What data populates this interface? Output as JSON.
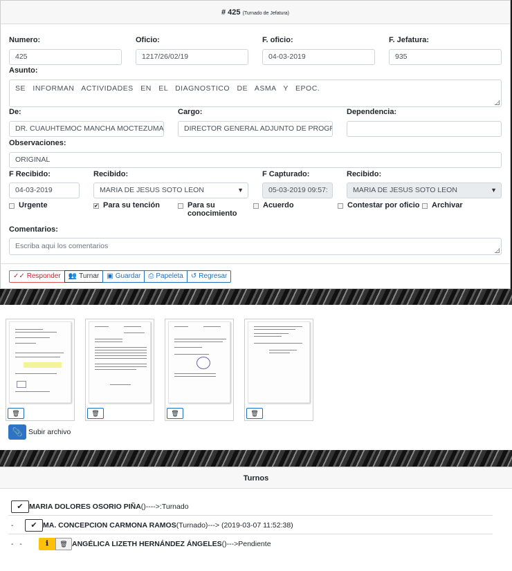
{
  "header": {
    "title": "# 425",
    "subtitle": "(Turnado de Jefatura)"
  },
  "form": {
    "numero": {
      "label": "Numero:",
      "value": "425"
    },
    "oficio": {
      "label": "Oficio:",
      "value": "1217/26/02/19"
    },
    "f_oficio": {
      "label": "F. oficio:",
      "value": "04-03-2019"
    },
    "f_jefatura": {
      "label": "F. Jefatura:",
      "value": "935"
    },
    "asunto": {
      "label": "Asunto:",
      "value": "SE INFORMAN ACTIVIDADES EN EL DIAGNOSTICO DE ASMA Y EPOC."
    },
    "de": {
      "label": "De:",
      "value": "DR. CUAUHTEMOC MANCHA MOCTEZUMA"
    },
    "cargo": {
      "label": "Cargo:",
      "value": "DIRECTOR GENERAL ADJUNTO DE PROGRAI"
    },
    "dependencia": {
      "label": "Dependencia:",
      "value": ""
    },
    "observaciones": {
      "label": "Observaciones:",
      "value": "ORIGINAL"
    },
    "f_recibido": {
      "label": "F Recibido:",
      "value": "04-03-2019"
    },
    "recibido": {
      "label": "Recibido:",
      "value": "MARIA DE JESUS SOTO LEON"
    },
    "f_capturado": {
      "label": "F Capturado:",
      "value": "05-03-2019 09:57:"
    },
    "recibido2": {
      "label": "Recibido:",
      "value": "MARIA DE JESUS SOTO LEON"
    },
    "checks": {
      "urgente": "Urgente",
      "tencion": "Para su tención",
      "conocimiento_1": "Para su",
      "conocimiento_2": "conocimiento",
      "acuerdo": "Acuerdo",
      "contestar": "Contestar por oficio",
      "archivar": "Archivar"
    },
    "comentarios": {
      "label": "Comentarios:",
      "placeholder": "Escriba aqui los comentarios"
    }
  },
  "buttons": {
    "responder": "Responder",
    "turnar": "Turnar",
    "guardar": "Guardar",
    "papeleta": "Papeleta",
    "regresar": "Regresar"
  },
  "files": {
    "upload_label": "Subir archivo",
    "count": 4
  },
  "turnos": {
    "title": "Turnos",
    "rows": [
      {
        "prefix": "",
        "name": "MARIA DOLORES OSORIO PIÑA",
        "detail": " ()---->:Turnado"
      },
      {
        "prefix": "-",
        "name": "MA. CONCEPCION CARMONA RAMOS",
        "detail": " (Turnado)---> (2019-03-07 11:52:38)"
      },
      {
        "prefix": "-   -",
        "name": "ANGÉLICA LIZETH HERNÁNDEZ ÁNGELES",
        "detail": " ()--->Pendiente"
      }
    ]
  },
  "colors": {
    "primary": "#1e6fbf",
    "danger": "#d9534f",
    "warning": "#ffc107"
  }
}
